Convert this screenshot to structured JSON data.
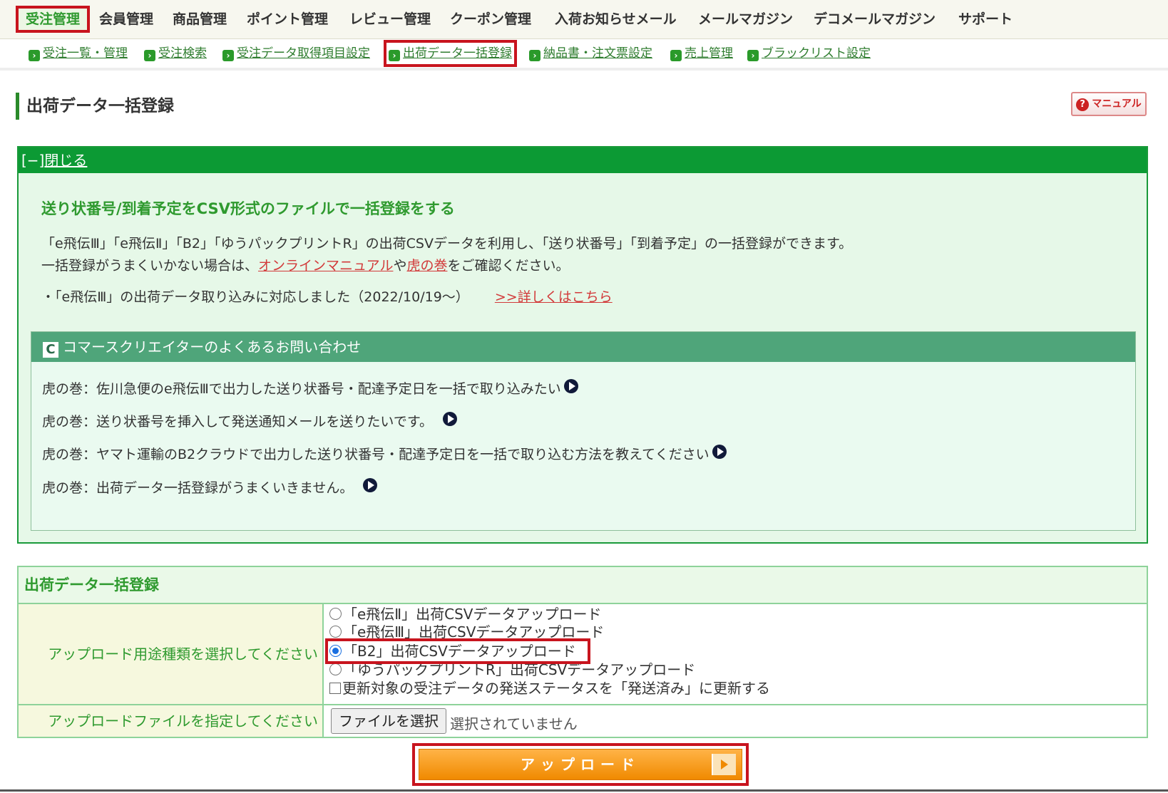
{
  "topnav": [
    {
      "label": "受注管理",
      "active": true
    },
    {
      "label": "会員管理"
    },
    {
      "label": "商品管理"
    },
    {
      "label": "ポイント管理"
    },
    {
      "label": "レビュー管理"
    },
    {
      "label": "クーポン管理"
    },
    {
      "label": "入荷お知らせメール"
    },
    {
      "label": "メールマガジン"
    },
    {
      "label": "デコメールマガジン"
    },
    {
      "label": "サポート"
    }
  ],
  "subnav": [
    {
      "label": "受注一覧・管理"
    },
    {
      "label": "受注検索"
    },
    {
      "label": "受注データ取得項目設定"
    },
    {
      "label": "出荷データ一括登録",
      "highlighted": true
    },
    {
      "label": "納品書・注文票設定"
    },
    {
      "label": "売上管理"
    },
    {
      "label": "ブラックリスト設定"
    }
  ],
  "page": {
    "title": "出荷データ一括登録",
    "manual_label": "マニュアル"
  },
  "info": {
    "toggle_prefix": "[−]",
    "toggle_label": "閉じる",
    "heading": "送り状番号/到着予定をCSV形式のファイルで一括登録をする",
    "line1": "「e飛伝Ⅲ」「e飛伝Ⅱ」「B2」「ゆうパックプリントR」の出荷CSVデータを利用し、「送り状番号」「到着予定」の一括登録ができます。",
    "line2_prefix": "一括登録がうまくいかない場合は、",
    "line2_link1": "オンラインマニュアル",
    "line2_mid": "や",
    "line2_link2": "虎の巻",
    "line2_suffix": "をご確認ください。",
    "notice": "・「e飛伝Ⅲ」の出荷データ取り込みに対応しました（2022/10/19～）",
    "notice_link": ">>詳しくはこちら"
  },
  "faq": {
    "heading": "コマースクリエイターのよくあるお問い合わせ",
    "items": [
      "虎の巻：佐川急便のe飛伝Ⅲで出力した送り状番号・配達予定日を一括で取り込みたい",
      "虎の巻：送り状番号を挿入して発送通知メールを送りたいです。",
      "虎の巻：ヤマト運輸のB2クラウドで出力した送り状番号・配達予定日を一括で取り込む方法を教えてください",
      "虎の巻：出荷データ一括登録がうまくいきません。"
    ]
  },
  "form": {
    "heading": "出荷データ一括登録",
    "type_label": "アップロード用途種類を選択してください",
    "options": [
      {
        "label": "「e飛伝Ⅱ」出荷CSVデータアップロード",
        "checked": false
      },
      {
        "label": "「e飛伝Ⅲ」出荷CSVデータアップロード",
        "checked": false
      },
      {
        "label": "「B2」出荷CSVデータアップロード",
        "checked": true
      },
      {
        "label": "「ゆうパックプリントR」出荷CSVデータアップロード",
        "checked": false
      }
    ],
    "status_checkbox_label": "更新対象の受注データの発送ステータスを「発送済み」に更新する",
    "file_label": "アップロードファイルを指定してください",
    "file_button": "ファイルを選択",
    "file_status": "選択されていません",
    "submit_label": "アップロード"
  }
}
